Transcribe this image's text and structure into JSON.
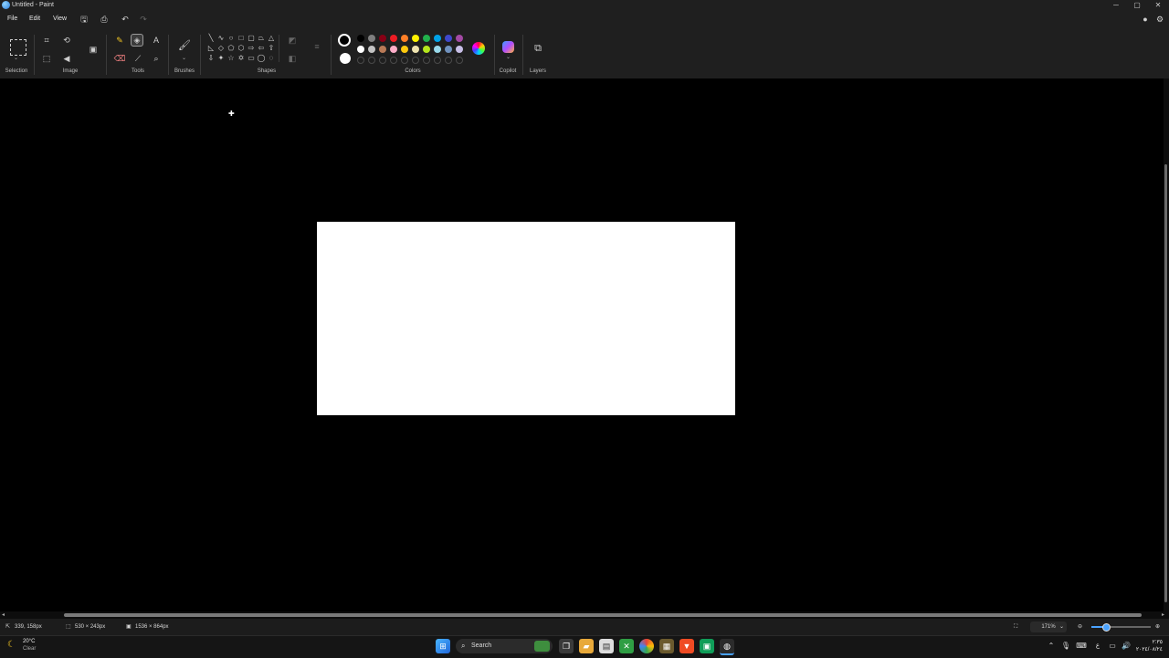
{
  "window": {
    "title": "Untitled - Paint",
    "controls": [
      "─",
      "▢",
      "✕"
    ]
  },
  "menu": {
    "items": [
      "File",
      "Edit",
      "View"
    ]
  },
  "ribbon": {
    "groups": [
      "Selection",
      "Image",
      "Tools",
      "Brushes",
      "Shapes",
      "Colors",
      "Copilot",
      "Layers"
    ]
  },
  "colors": {
    "primary": "#000000",
    "secondary": "#ffffff",
    "palette_row1": [
      "#000000",
      "#7f7f7f",
      "#880015",
      "#ed1c24",
      "#ff7f27",
      "#fff200",
      "#22b14c",
      "#00a2e8",
      "#3f48cc",
      "#a349a4"
    ],
    "palette_row2": [
      "#ffffff",
      "#c3c3c3",
      "#b97a57",
      "#ffaec9",
      "#ffc90e",
      "#efe4b0",
      "#b5e61d",
      "#99d9ea",
      "#7092be",
      "#c8bfe7"
    ]
  },
  "status": {
    "cursor_pos": "339, 158px",
    "selection_size": "530 × 243px",
    "canvas_size": "1536 × 864px",
    "zoom": "171%"
  },
  "taskbar": {
    "weather_temp": "20°C",
    "weather_desc": "Clear",
    "search_placeholder": "Search",
    "clock_time": "٢:٣٥",
    "clock_date": "٢٠٢٤/٠٨/٢٤"
  }
}
